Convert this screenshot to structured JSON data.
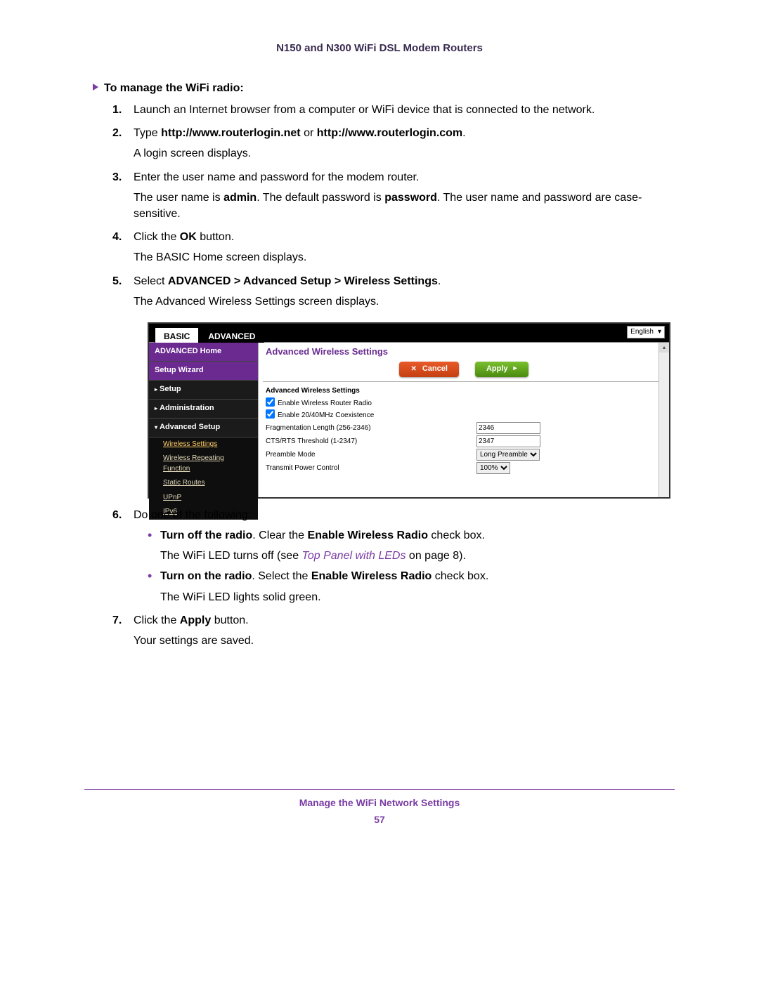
{
  "header": "N150 and N300 WiFi DSL Modem Routers",
  "task_title": "To manage the WiFi radio:",
  "steps": {
    "s1": "Launch an Internet browser from a computer or WiFi device that is connected to the network.",
    "s2_pre": "Type ",
    "s2_b1": "http://www.routerlogin.net",
    "s2_mid": " or ",
    "s2_b2": "http://www.routerlogin.com",
    "s2_post": ".",
    "s2_p": "A login screen displays.",
    "s3": "Enter the user name and password for the modem router.",
    "s3_p_pre": "The user name is ",
    "s3_p_b1": "admin",
    "s3_p_mid": ". The default password is ",
    "s3_p_b2": "password",
    "s3_p_post": ". The user name and password are case-sensitive.",
    "s4_pre": "Click the ",
    "s4_b": "OK",
    "s4_post": " button.",
    "s4_p": "The BASIC Home screen displays.",
    "s5_pre": "Select ",
    "s5_b": "ADVANCED > Advanced Setup > Wireless Settings",
    "s5_post": ".",
    "s5_p": "The Advanced Wireless Settings screen displays.",
    "s6": "Do one of the following:",
    "s6a_b1": "Turn off the radio",
    "s6a_t1": ". Clear the ",
    "s6a_b2": "Enable Wireless Radio",
    "s6a_t2": " check box.",
    "s6a_p_pre": "The WiFi LED turns off (see ",
    "s6a_link": "Top Panel with LEDs",
    "s6a_p_post": " on page 8).",
    "s6b_b1": "Turn on the radio",
    "s6b_t1": ". Select the ",
    "s6b_b2": "Enable Wireless Radio",
    "s6b_t2": " check box.",
    "s6b_p": "The WiFi LED lights solid green.",
    "s7_pre": "Click the ",
    "s7_b": "Apply",
    "s7_post": " button.",
    "s7_p": "Your settings are saved."
  },
  "ui": {
    "tab_basic": "BASIC",
    "tab_advanced": "ADVANCED",
    "language": "English",
    "sidebar": {
      "home": "ADVANCED Home",
      "wizard": "Setup Wizard",
      "setup": "Setup",
      "admin": "Administration",
      "advsetup": "Advanced Setup",
      "sub": {
        "ws": "Wireless Settings",
        "wrf": "Wireless Repeating Function",
        "sr": "Static Routes",
        "upnp": "UPnP",
        "ipv6": "IPv6"
      }
    },
    "content": {
      "title": "Advanced Wireless Settings",
      "cancel": "Cancel",
      "apply": "Apply",
      "section": "Advanced Wireless Settings",
      "enable_radio": "Enable Wireless Router Radio",
      "enable_coex": "Enable 20/40MHz Coexistence",
      "frag_label": "Fragmentation Length (256-2346)",
      "frag_value": "2346",
      "cts_label": "CTS/RTS Threshold (1-2347)",
      "cts_value": "2347",
      "preamble_label": "Preamble Mode",
      "preamble_value": "Long Preamble",
      "tx_label": "Transmit Power Control",
      "tx_value": "100%"
    }
  },
  "footer": {
    "title": "Manage the WiFi Network Settings",
    "page": "57"
  }
}
